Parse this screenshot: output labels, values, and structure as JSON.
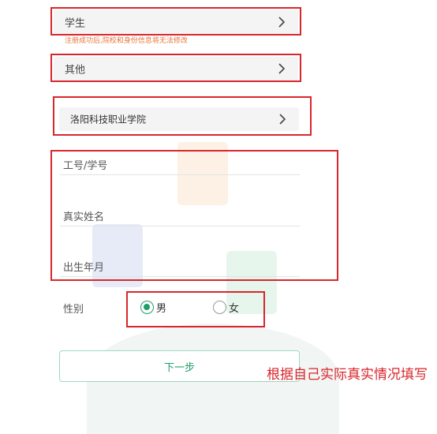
{
  "identity": {
    "value": "学生",
    "note": "注册成功后,院校和身份信息将无法修改"
  },
  "other": {
    "value": "其他"
  },
  "school": {
    "value": "洛阳科技职业学院"
  },
  "form": {
    "id_label": "工号/学号",
    "name_label": "真实姓名",
    "birth_label": "出生年月",
    "gender_label": "性别",
    "gender_male": "男",
    "gender_female": "女",
    "gender_selected": "男"
  },
  "next_button": "下一步",
  "annotation": "根据自己实际真实情况填写",
  "colors": {
    "accent": "#1f9e6a",
    "annotation_red": "#d9262c",
    "note_orange": "#e8743b"
  }
}
